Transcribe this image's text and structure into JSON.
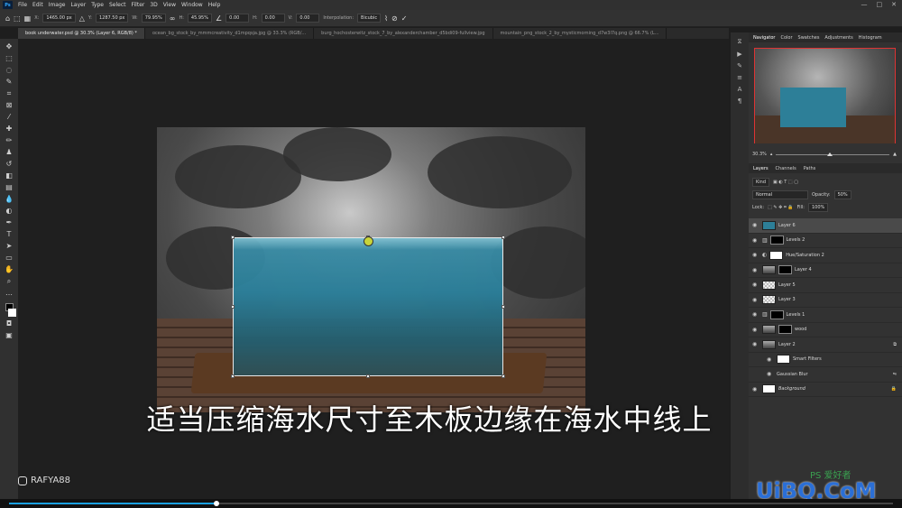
{
  "app": {
    "logo": "Ps"
  },
  "menu": [
    "File",
    "Edit",
    "Image",
    "Layer",
    "Type",
    "Select",
    "Filter",
    "3D",
    "View",
    "Window",
    "Help"
  ],
  "window_controls": [
    "—",
    "□",
    "✕"
  ],
  "options": {
    "x_label": "X:",
    "x_value": "1465.00 px",
    "y_label": "Y:",
    "y_value": "1287.50 px",
    "w_label": "W:",
    "w_value": "79.95%",
    "h_label": "H:",
    "h_value": "45.95%",
    "angle_value": "0.00",
    "hskew_label": "H:",
    "hskew_value": "0.00",
    "vskew_label": "V:",
    "vskew_value": "0.00",
    "interp_label": "Interpolation:",
    "interp_value": "Bicubic"
  },
  "tabs": [
    "book underwater.psd @ 30.3% (Layer 6, RGB/8) *",
    "ocean_bg_stock_by_mmmcreativity_d1mpqsja.jpg @ 33.3% (RGB/...",
    "burg_hochosterwitz_stock_7_by_alexanderchamber_d5bdi09-fullview.jpg",
    "mountain_png_stock_2_by_mysticmorning_d7w3l7q.png @ 66.7% (L..."
  ],
  "subtitle": "适当压缩海水尺寸至木板边缘在海水中线上",
  "credit": "RAFYA88",
  "watermark": {
    "main": "UiBQ.CoM",
    "small": "PS 爱好者"
  },
  "navigator": {
    "tabs": [
      "Navigator",
      "Color",
      "Swatches",
      "Adjustments",
      "Histogram"
    ],
    "zoom": "30.3%"
  },
  "layers_panel": {
    "tabs": [
      "Layers",
      "Channels",
      "Paths"
    ],
    "kind": "Kind",
    "blend": "Normal",
    "opacity_label": "Opacity:",
    "opacity": "50%",
    "lock_label": "Lock:",
    "fill_label": "Fill:",
    "fill": "100%",
    "layers": [
      {
        "name": "Layer 6",
        "thumb": "wat",
        "mask": "",
        "selected": true
      },
      {
        "name": "Levels 2",
        "thumb": "adj",
        "mask": "b",
        "selected": false
      },
      {
        "name": "Hue/Saturation 2",
        "thumb": "adj",
        "mask": "w",
        "selected": false
      },
      {
        "name": "Layer 4",
        "thumb": "sky",
        "mask": "b",
        "selected": false
      },
      {
        "name": "Layer 5",
        "thumb": "chk",
        "mask": "",
        "selected": false
      },
      {
        "name": "Layer 3",
        "thumb": "chk",
        "mask": "",
        "selected": false
      },
      {
        "name": "Levels 1",
        "thumb": "adj",
        "mask": "b",
        "selected": false
      },
      {
        "name": "wood",
        "thumb": "sky",
        "mask": "b",
        "selected": false
      },
      {
        "name": "Layer 2",
        "thumb": "sky",
        "mask": "",
        "selected": false
      },
      {
        "name": "Smart Filters",
        "thumb": "w",
        "mask": "",
        "selected": false
      },
      {
        "name": "Gaussian Blur",
        "thumb": "",
        "mask": "",
        "selected": false
      },
      {
        "name": "Background",
        "thumb": "w",
        "mask": "",
        "selected": false
      }
    ]
  },
  "video": {
    "progress": 0.235
  }
}
